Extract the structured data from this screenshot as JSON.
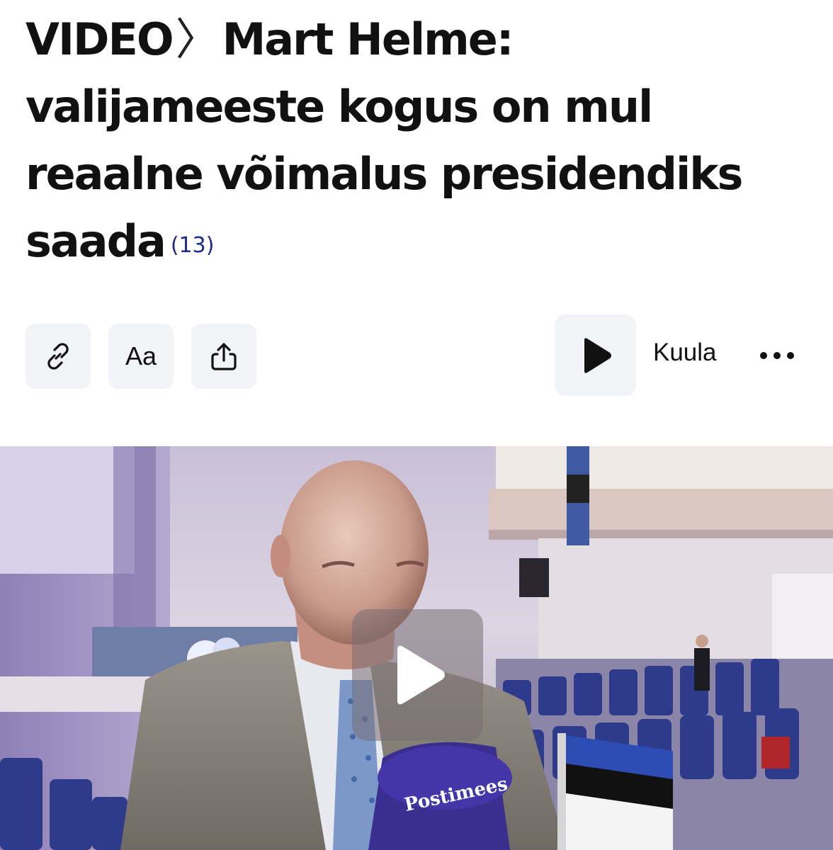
{
  "article": {
    "section": "VIDEO",
    "separator": "〉",
    "title": "Mart Helme: valijameeste kogus on mul reaalne võimalus presidendiks saada",
    "comment_count": "(13)"
  },
  "toolbar": {
    "copy_link_icon": "link-icon",
    "font_size_label": "Aa",
    "share_icon": "share-icon",
    "listen_label": "Kuula",
    "play_icon": "play-icon",
    "more_icon": "more-dots-icon"
  },
  "video": {
    "microphone_brand": "Postimees",
    "play_icon": "play-icon"
  },
  "colors": {
    "comment_count": "#1f2a8c",
    "button_bg": "#f1f3f6",
    "text": "#111111"
  }
}
